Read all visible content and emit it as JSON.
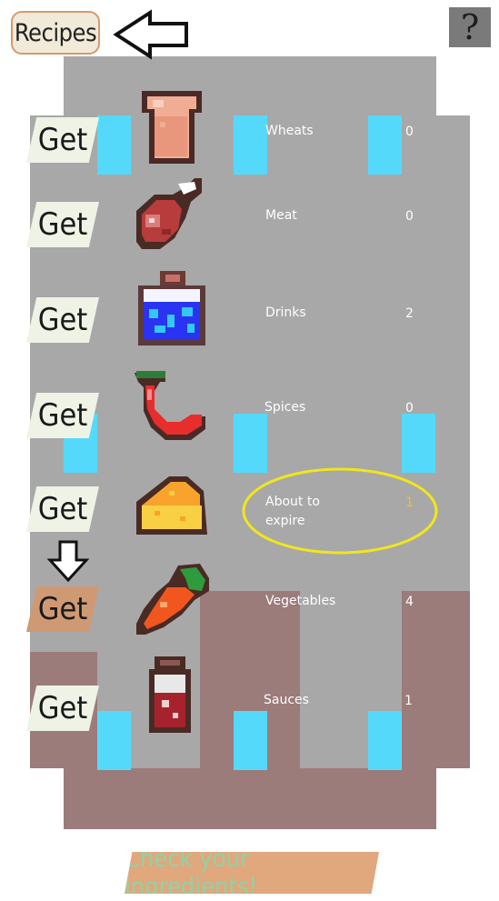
{
  "header": {
    "recipes_label": "Recipes",
    "help_label": "?"
  },
  "ingredients": [
    {
      "get_label": "Get",
      "icon": "bread-icon",
      "name": "Wheats",
      "count": "0"
    },
    {
      "get_label": "Get",
      "icon": "meat-icon",
      "name": "Meat",
      "count": "0"
    },
    {
      "get_label": "Get",
      "icon": "drink-icon",
      "name": "Drinks",
      "count": "2"
    },
    {
      "get_label": "Get",
      "icon": "chili-pepper-icon",
      "name": "Spices",
      "count": "0"
    },
    {
      "get_label": "Get",
      "icon": "cheese-icon",
      "name": "About to expire",
      "count": "1"
    },
    {
      "get_label": "Get",
      "icon": "carrot-icon",
      "name": "Vegetables",
      "count": "4"
    },
    {
      "get_label": "Get",
      "icon": "sauce-bottle-icon",
      "name": "Sauces",
      "count": "1"
    }
  ],
  "footer": {
    "check_label": "Check your ingredients!"
  },
  "colors": {
    "floor_gray": "#a8a8a8",
    "floor_brown": "#9c7b7b",
    "window_cyan": "#55d9fb",
    "highlight_yellow": "#f0e61c",
    "get_bg": "#eef3e6",
    "get_highlight_bg": "#cf9a73"
  }
}
